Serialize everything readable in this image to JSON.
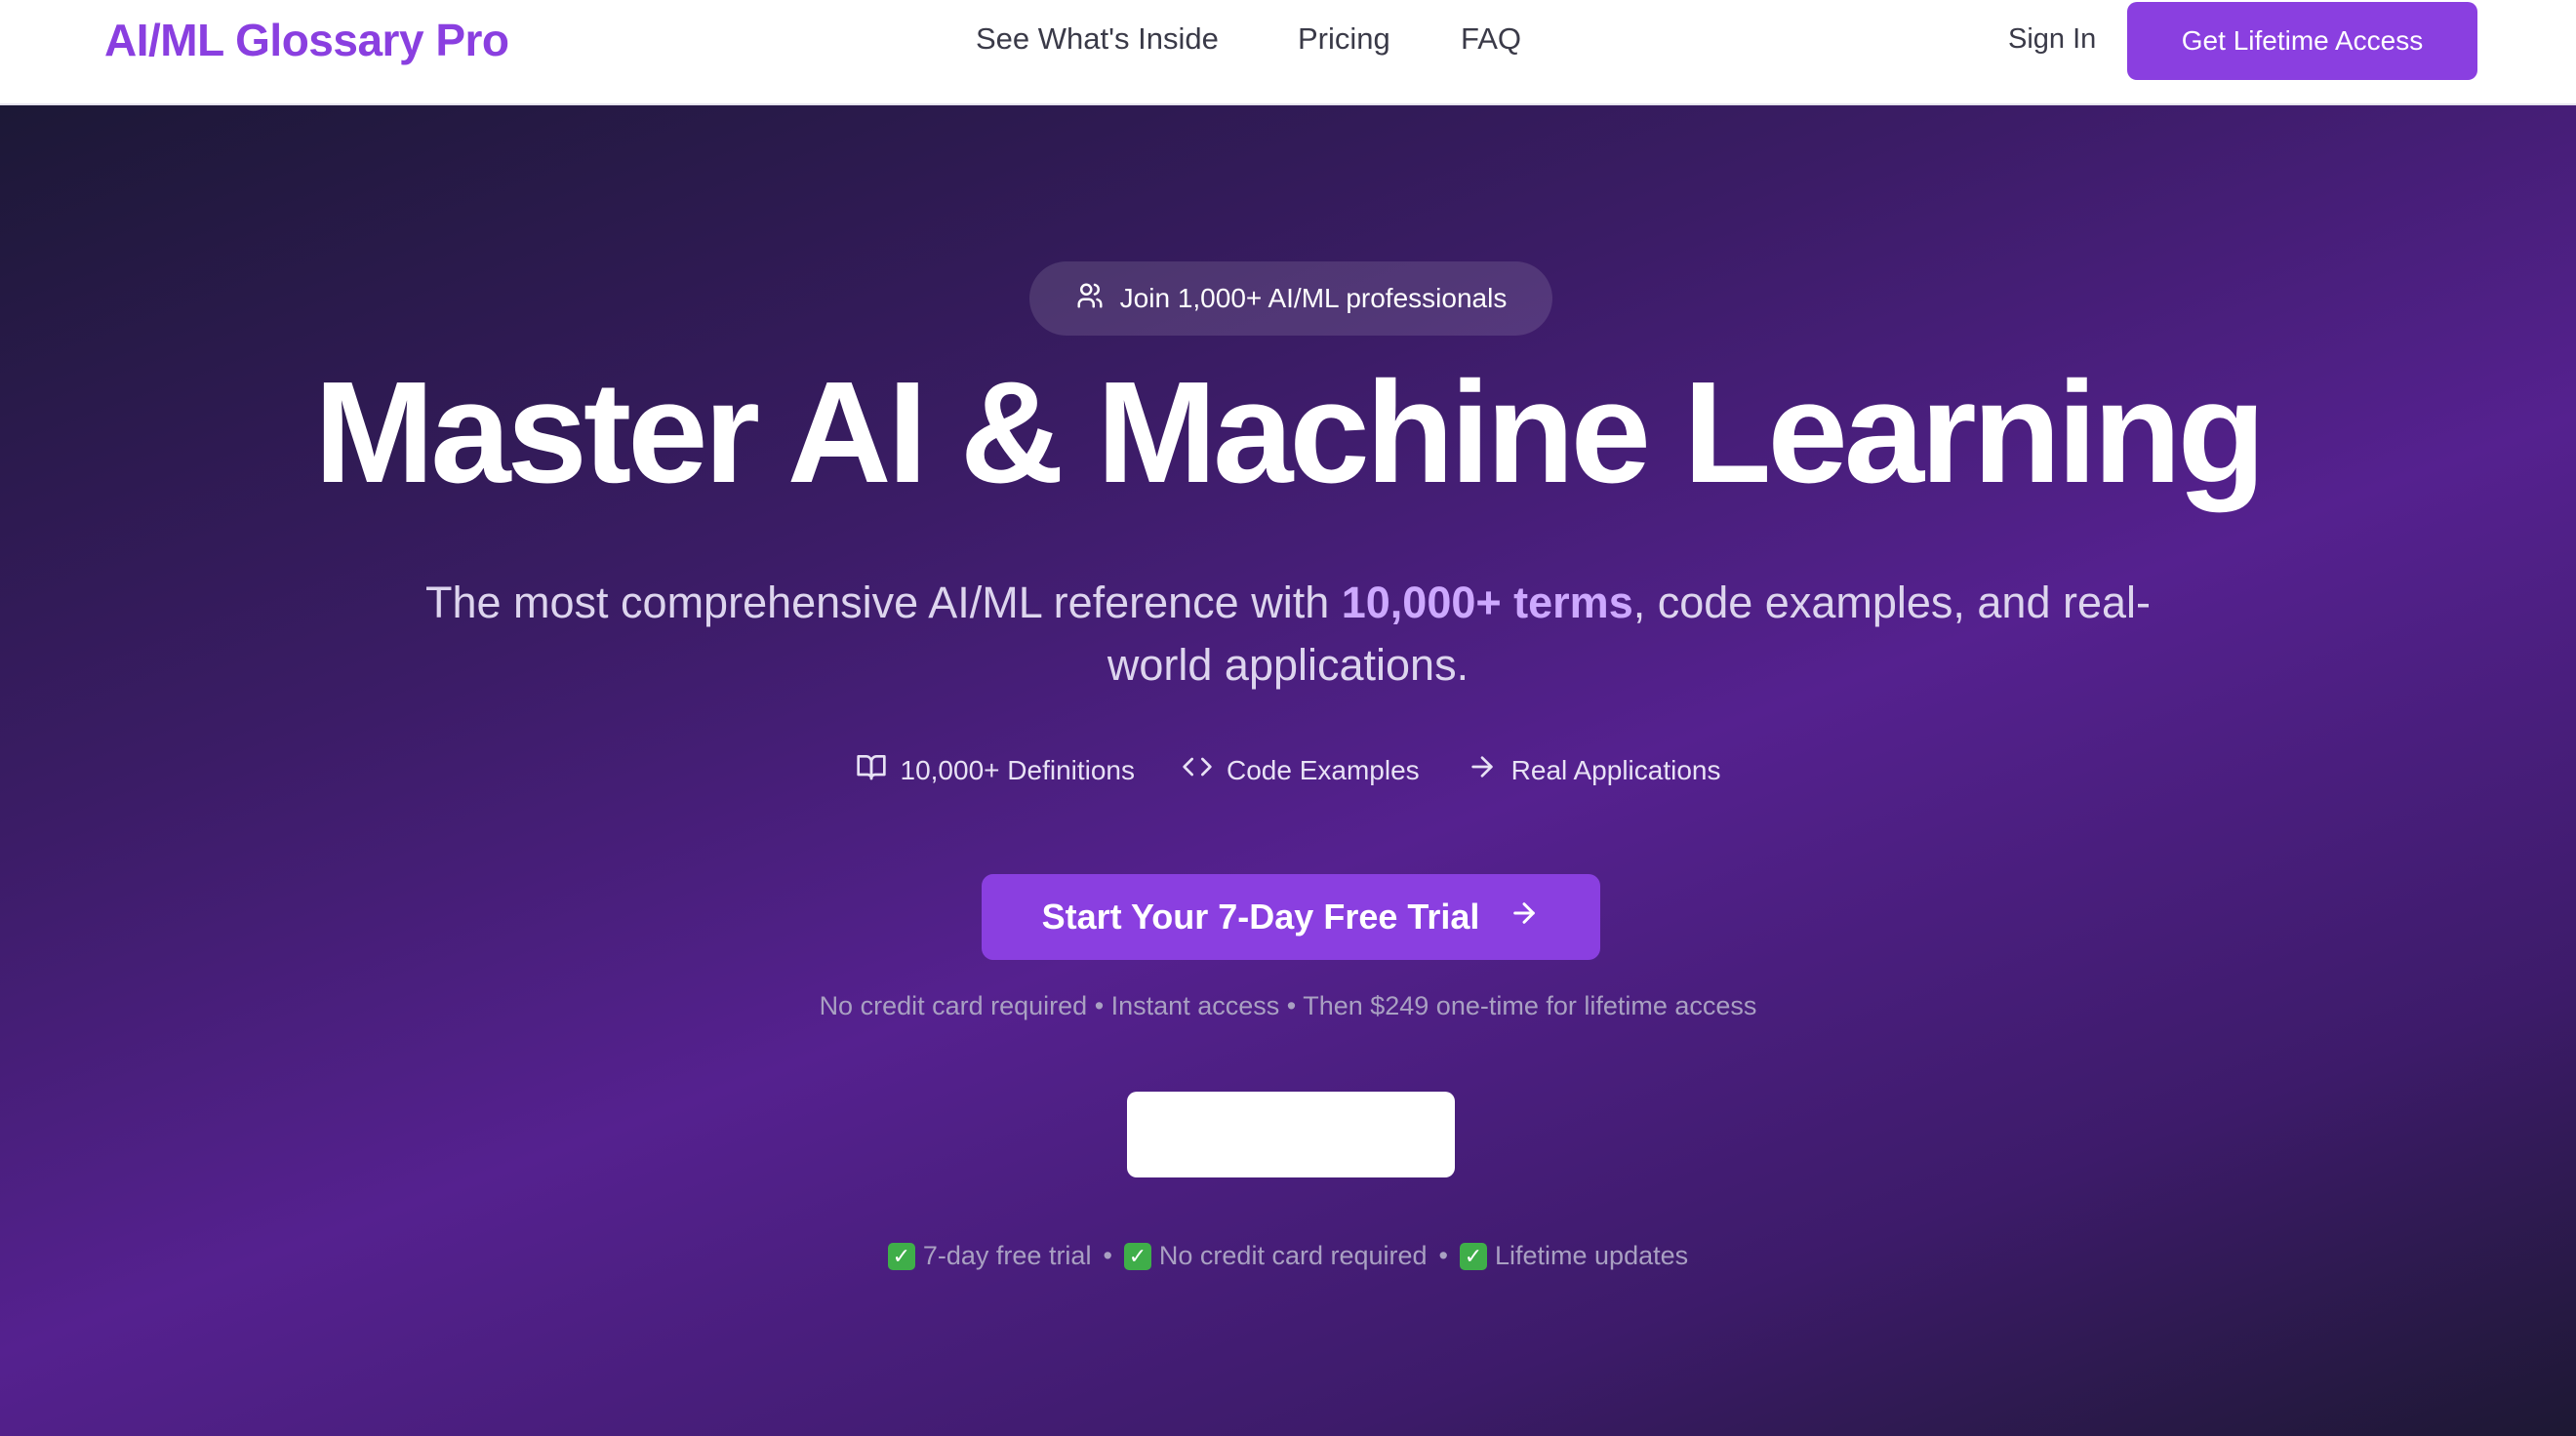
{
  "nav": {
    "logo": "AI/ML Glossary Pro",
    "links": [
      "See What's Inside",
      "Pricing",
      "FAQ"
    ],
    "sign_in": "Sign In",
    "cta": "Get Lifetime Access"
  },
  "hero": {
    "badge": "Join 1,000+ AI/ML professionals",
    "headline": "Master AI & Machine Learning",
    "sub_before": "The most comprehensive AI/ML reference with ",
    "sub_highlight": "10,000+ terms",
    "sub_after": ", code examples, and real-world applications.",
    "features": [
      {
        "icon": "book-open-icon",
        "label": "10,000+ Definitions"
      },
      {
        "icon": "code-icon",
        "label": "Code Examples"
      },
      {
        "icon": "arrow-right-icon",
        "label": "Real Applications"
      }
    ],
    "cta": "Start Your 7-Day Free Trial",
    "fineprint": "No credit card required • Instant access • Then $249 one-time for lifetime access",
    "checks": [
      "7-day free trial",
      "No credit card required",
      "Lifetime updates"
    ],
    "separator": "•"
  },
  "colors": {
    "accent": "#8a3fe0",
    "highlight": "#cda8ff",
    "check_green": "#3fae49"
  }
}
